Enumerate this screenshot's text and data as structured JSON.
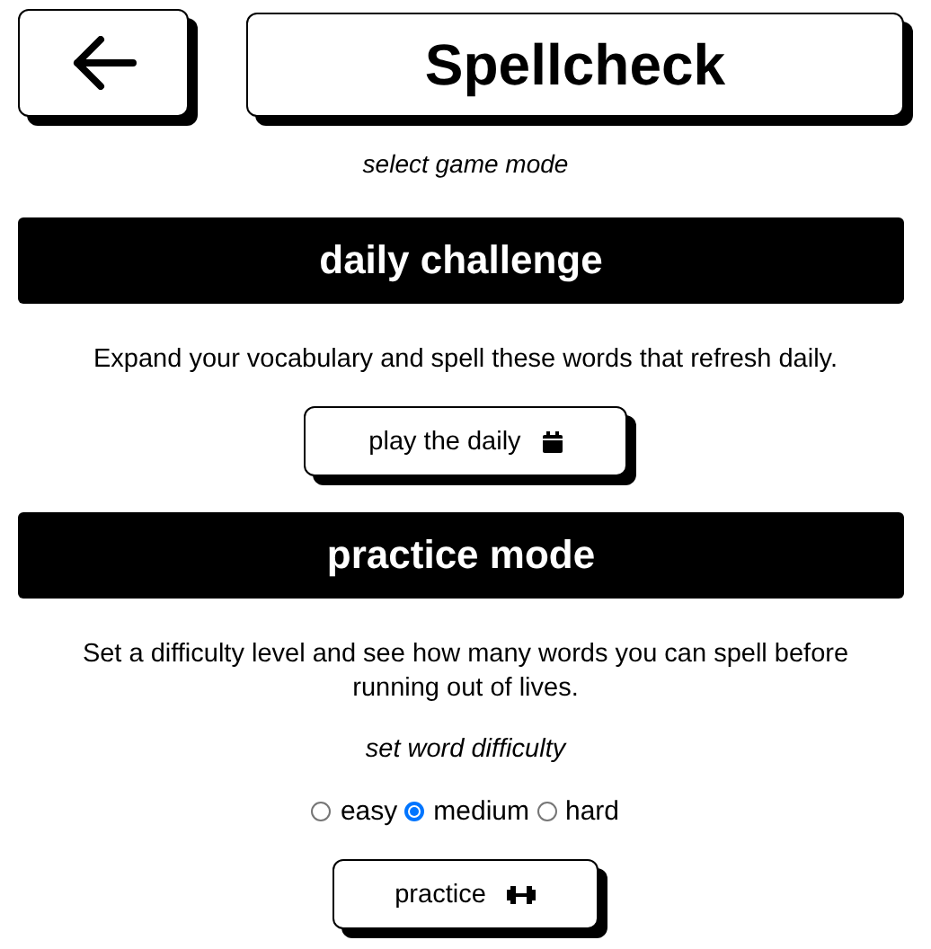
{
  "header": {
    "title": "Spellcheck"
  },
  "subtitle": "select game mode",
  "sections": [
    {
      "kind": "daily",
      "heading": "daily challenge",
      "description": "Expand your vocabulary and spell these words that refresh daily.",
      "button": "play the daily"
    },
    {
      "kind": "practice",
      "heading": "practice mode",
      "description": "Set a difficulty level and see how many words you can spell before running out of lives.",
      "difficulty_label": "set word difficulty",
      "difficulties": [
        {
          "label": "easy",
          "selected": false
        },
        {
          "label": "medium",
          "selected": true
        },
        {
          "label": "hard",
          "selected": false
        }
      ],
      "button": "practice"
    }
  ]
}
